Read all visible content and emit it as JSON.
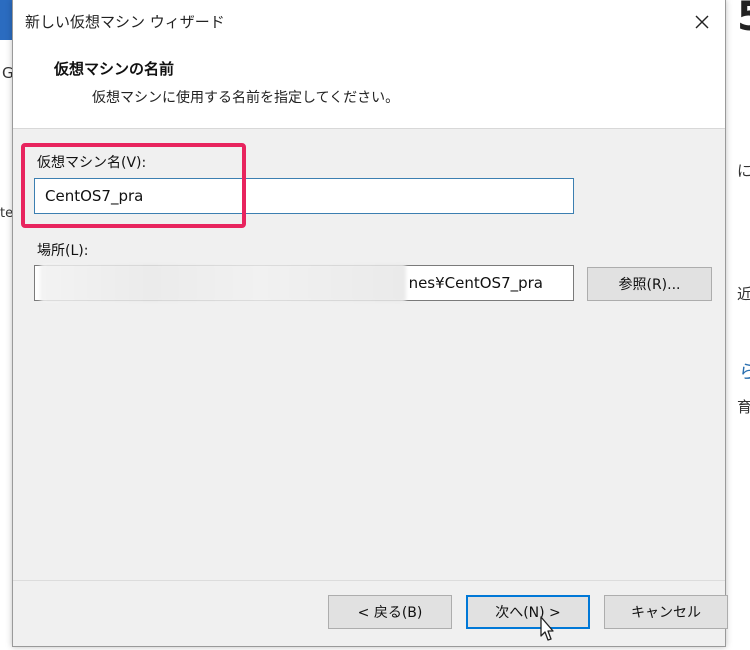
{
  "window": {
    "title": "新しい仮想マシン ウィザード"
  },
  "header": {
    "title": "仮想マシンの名前",
    "description": "仮想マシンに使用する名前を指定してください。"
  },
  "form": {
    "vm_name_label": "仮想マシン名(V):",
    "vm_name_value": "CentOS7_pra",
    "location_label": "場所(L):",
    "location_visible_suffix": "nes¥CentOS7_pra",
    "browse_label": "参照(R)..."
  },
  "buttons": {
    "back": "< 戻る(B)",
    "next": "次へ(N) >",
    "cancel": "キャンセル"
  },
  "background": {
    "left_chars": [
      "G",
      "te"
    ],
    "right_chars": [
      "5",
      "に",
      "近",
      "ら",
      "育"
    ]
  },
  "colors": {
    "highlight": "#e8245e",
    "focus_border": "#3c7fb1",
    "default_button_border": "#0078d7"
  },
  "icons": {
    "close": "close-icon",
    "cursor": "mouse-pointer-icon"
  }
}
